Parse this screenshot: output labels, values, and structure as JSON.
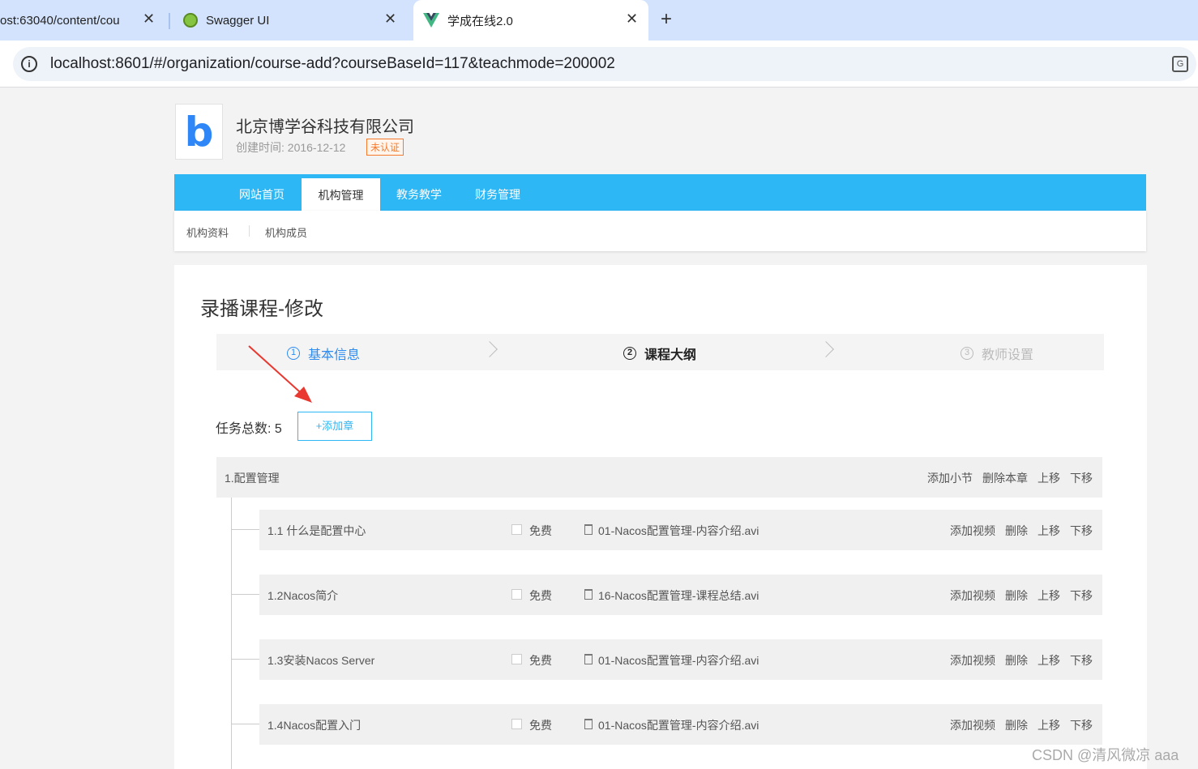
{
  "browser": {
    "tabs": [
      {
        "title": "ost:63040/content/cou",
        "close": "✕"
      },
      {
        "title": "Swagger UI",
        "close": "✕"
      },
      {
        "title": "学成在线2.0",
        "close": "✕"
      }
    ],
    "new_tab": "+",
    "url": "localhost:8601/#/organization/course-add?courseBaseId=117&teachmode=200002"
  },
  "org": {
    "logo_letter": "b",
    "name": "北京博学谷科技有限公司",
    "created": "创建时间: 2016-12-12",
    "badge": "未认证"
  },
  "nav": {
    "items": [
      "网站首页",
      "机构管理",
      "教务教学",
      "财务管理"
    ],
    "active": "机构管理",
    "sub_items": [
      "机构资料",
      "机构成员"
    ]
  },
  "page": {
    "title": "录播课程-修改",
    "steps": [
      {
        "num": "1",
        "label": "基本信息",
        "state": "done"
      },
      {
        "num": "2",
        "label": "课程大纲",
        "state": "current"
      },
      {
        "num": "3",
        "label": "教师设置",
        "state": "pending"
      }
    ],
    "task_total_label": "任务总数: ",
    "task_total": "5",
    "add_chapter": "+添加章"
  },
  "chapter": {
    "title": "1.配置管理",
    "actions": [
      "添加小节",
      "删除本章",
      "上移",
      "下移"
    ]
  },
  "sections": [
    {
      "title": "1.1 什么是配置中心",
      "free": "免费",
      "video": "01-Nacos配置管理-内容介绍.avi"
    },
    {
      "title": "1.2Nacos简介",
      "free": "免费",
      "video": "16-Nacos配置管理-课程总结.avi"
    },
    {
      "title": "1.3安装Nacos Server",
      "free": "免费",
      "video": "01-Nacos配置管理-内容介绍.avi"
    },
    {
      "title": "1.4Nacos配置入门",
      "free": "免费",
      "video": "01-Nacos配置管理-内容介绍.avi"
    }
  ],
  "section_actions": [
    "添加视频",
    "删除",
    "上移",
    "下移"
  ],
  "watermark": "CSDN @清风微凉 aaa",
  "colors": {
    "nav": "#2db7f5",
    "step_done": "#2d8cf0",
    "badge": "#f57a2c",
    "arrow": "#e8382f"
  }
}
